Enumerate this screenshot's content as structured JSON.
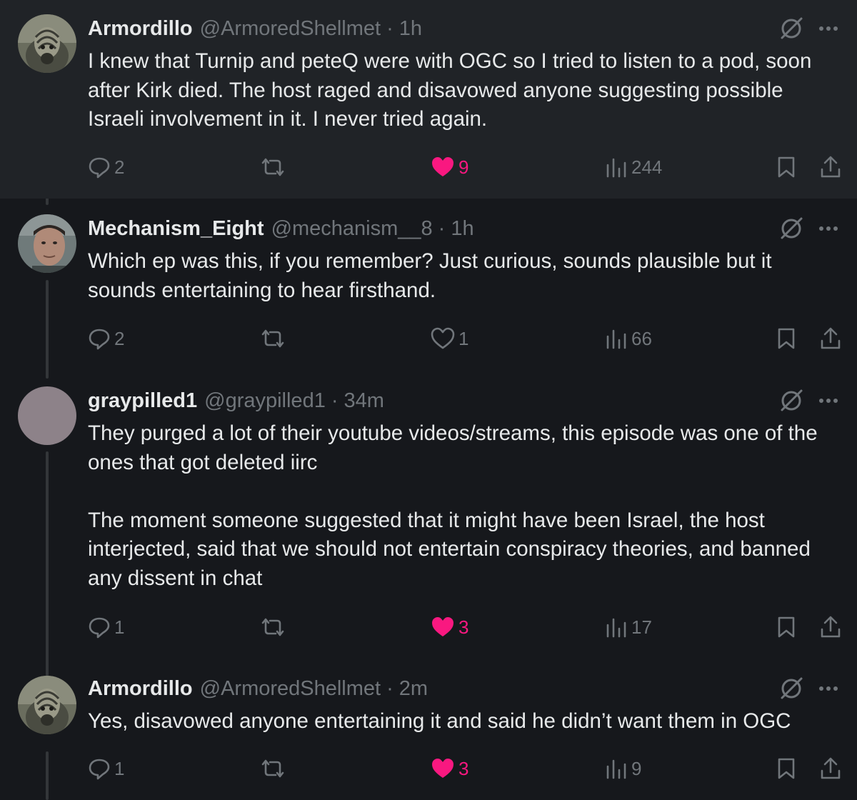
{
  "tweets": [
    {
      "name": "Armordillo",
      "handle": "@ArmoredShellmet",
      "time": "1h",
      "text": "I knew that Turnip and peteQ were with OGC so I tried to listen to a pod, soon after Kirk died. The host raged and disavowed anyone suggesting possible Israeli involvement in it.  I never tried again.",
      "replies": "2",
      "likes": "9",
      "liked": true,
      "views": "244"
    },
    {
      "name": "Mechanism_Eight",
      "handle": "@mechanism__8",
      "time": "1h",
      "text": "Which ep was this, if you remember? Just curious, sounds plausible but it sounds entertaining to hear firsthand.",
      "replies": "2",
      "likes": "1",
      "liked": false,
      "views": "66"
    },
    {
      "name": "graypilled1",
      "handle": "@graypilled1",
      "time": "34m",
      "text": "They purged a lot of their youtube videos/streams, this episode was one of the ones that got deleted iirc\n\nThe moment someone suggested that it might have been Israel, the host interjected, said that we should not entertain conspiracy theories, and banned any dissent in chat",
      "replies": "1",
      "likes": "3",
      "liked": true,
      "views": "17"
    },
    {
      "name": "Armordillo",
      "handle": "@ArmoredShellmet",
      "time": "2m",
      "text": "Yes, disavowed anyone entertaining it and said he didn’t want them in OGC",
      "replies": "1",
      "likes": "3",
      "liked": true,
      "views": "9"
    }
  ],
  "separator": "·",
  "colors": {
    "background": "#16181c",
    "highlight_background": "#202327",
    "text": "#e7e9ea",
    "muted": "#71767b",
    "like": "#f91880"
  },
  "icons": [
    "reply-icon",
    "repost-icon",
    "heart-icon",
    "views-icon",
    "bookmark-icon",
    "share-icon",
    "grok-icon",
    "more-icon"
  ]
}
